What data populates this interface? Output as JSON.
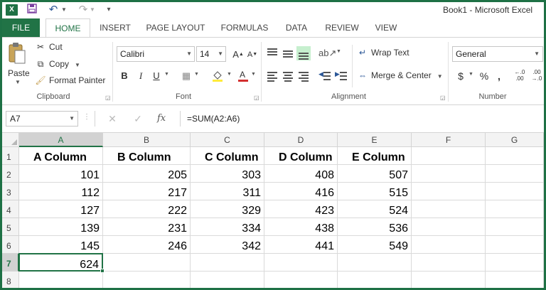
{
  "app": {
    "logo": "X",
    "title": "Book1 - Microsoft Excel"
  },
  "quick_access": {
    "save_icon": "save-icon",
    "undo_icon": "undo-icon",
    "redo_icon": "redo-icon"
  },
  "tabs": [
    {
      "label": "FILE"
    },
    {
      "label": "HOME"
    },
    {
      "label": "INSERT"
    },
    {
      "label": "PAGE LAYOUT"
    },
    {
      "label": "FORMULAS"
    },
    {
      "label": "DATA"
    },
    {
      "label": "REVIEW"
    },
    {
      "label": "VIEW"
    }
  ],
  "ribbon": {
    "clipboard": {
      "paste": "Paste",
      "cut": "Cut",
      "copy": "Copy",
      "format_painter": "Format Painter",
      "label": "Clipboard"
    },
    "font": {
      "name": "Calibri",
      "size": "14",
      "bold": "B",
      "italic": "I",
      "underline": "U",
      "label": "Font"
    },
    "alignment": {
      "wrap_text": "Wrap Text",
      "merge_center": "Merge & Center",
      "label": "Alignment"
    },
    "number": {
      "format": "General",
      "currency": "$",
      "percent": "%",
      "comma": ",",
      "label": "Number"
    }
  },
  "formula_bar": {
    "name_box": "A7",
    "fx": "fx",
    "formula": "=SUM(A2:A6)"
  },
  "grid": {
    "columns": [
      "A",
      "B",
      "C",
      "D",
      "E",
      "F",
      "G"
    ],
    "rows": [
      "1",
      "2",
      "3",
      "4",
      "5",
      "6",
      "7",
      "8"
    ],
    "header_row": [
      "A Column",
      "B Column",
      "C Column",
      "D Column",
      "E Column"
    ],
    "data": [
      [
        "101",
        "205",
        "303",
        "408",
        "507"
      ],
      [
        "112",
        "217",
        "311",
        "416",
        "515"
      ],
      [
        "127",
        "222",
        "329",
        "423",
        "524"
      ],
      [
        "139",
        "231",
        "334",
        "438",
        "536"
      ],
      [
        "145",
        "246",
        "342",
        "441",
        "549"
      ]
    ],
    "total": "624",
    "active_cell": "A7"
  },
  "colors": {
    "accent": "#217346",
    "frame": "#1e7145"
  }
}
